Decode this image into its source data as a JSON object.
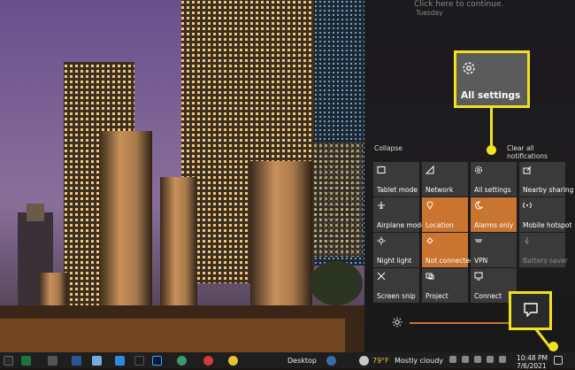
{
  "notification": {
    "text": "Click here to continue.",
    "day": "Tuesday"
  },
  "callout": {
    "label": "All settings"
  },
  "actions": {
    "collapse": "Collapse",
    "clear_all": "Clear all notifications"
  },
  "tiles": [
    {
      "label": "Tablet mode",
      "icon": "tablet-icon"
    },
    {
      "label": "Network",
      "icon": "network-icon"
    },
    {
      "label": "All settings",
      "icon": "gear-icon"
    },
    {
      "label": "Nearby sharing",
      "icon": "share-icon"
    },
    {
      "label": "Airplane mode",
      "icon": "airplane-icon"
    },
    {
      "label": "Location",
      "icon": "location-icon",
      "active": true
    },
    {
      "label": "Alarms only",
      "icon": "moon-icon",
      "active": true
    },
    {
      "label": "Mobile hotspot",
      "icon": "hotspot-icon"
    },
    {
      "label": "Night light",
      "icon": "sun-icon"
    },
    {
      "label": "Not connected",
      "icon": "vpn-icon",
      "active": true
    },
    {
      "label": "VPN",
      "icon": "vpn-link-icon"
    },
    {
      "label": "Battery saver",
      "icon": "battery-icon",
      "disabled": true
    },
    {
      "label": "Screen snip",
      "icon": "snip-icon"
    },
    {
      "label": "Project",
      "icon": "project-icon"
    },
    {
      "label": "Connect",
      "icon": "connect-icon"
    }
  ],
  "taskbar": {
    "desktop": "Desktop",
    "weather_temp": "79°F",
    "weather_desc": "Mostly cloudy",
    "time": "10:48 PM",
    "date": "7/6/2021"
  },
  "colors": {
    "accent": "#c9742f",
    "highlight": "#f1e21b",
    "panel": "#161616"
  }
}
